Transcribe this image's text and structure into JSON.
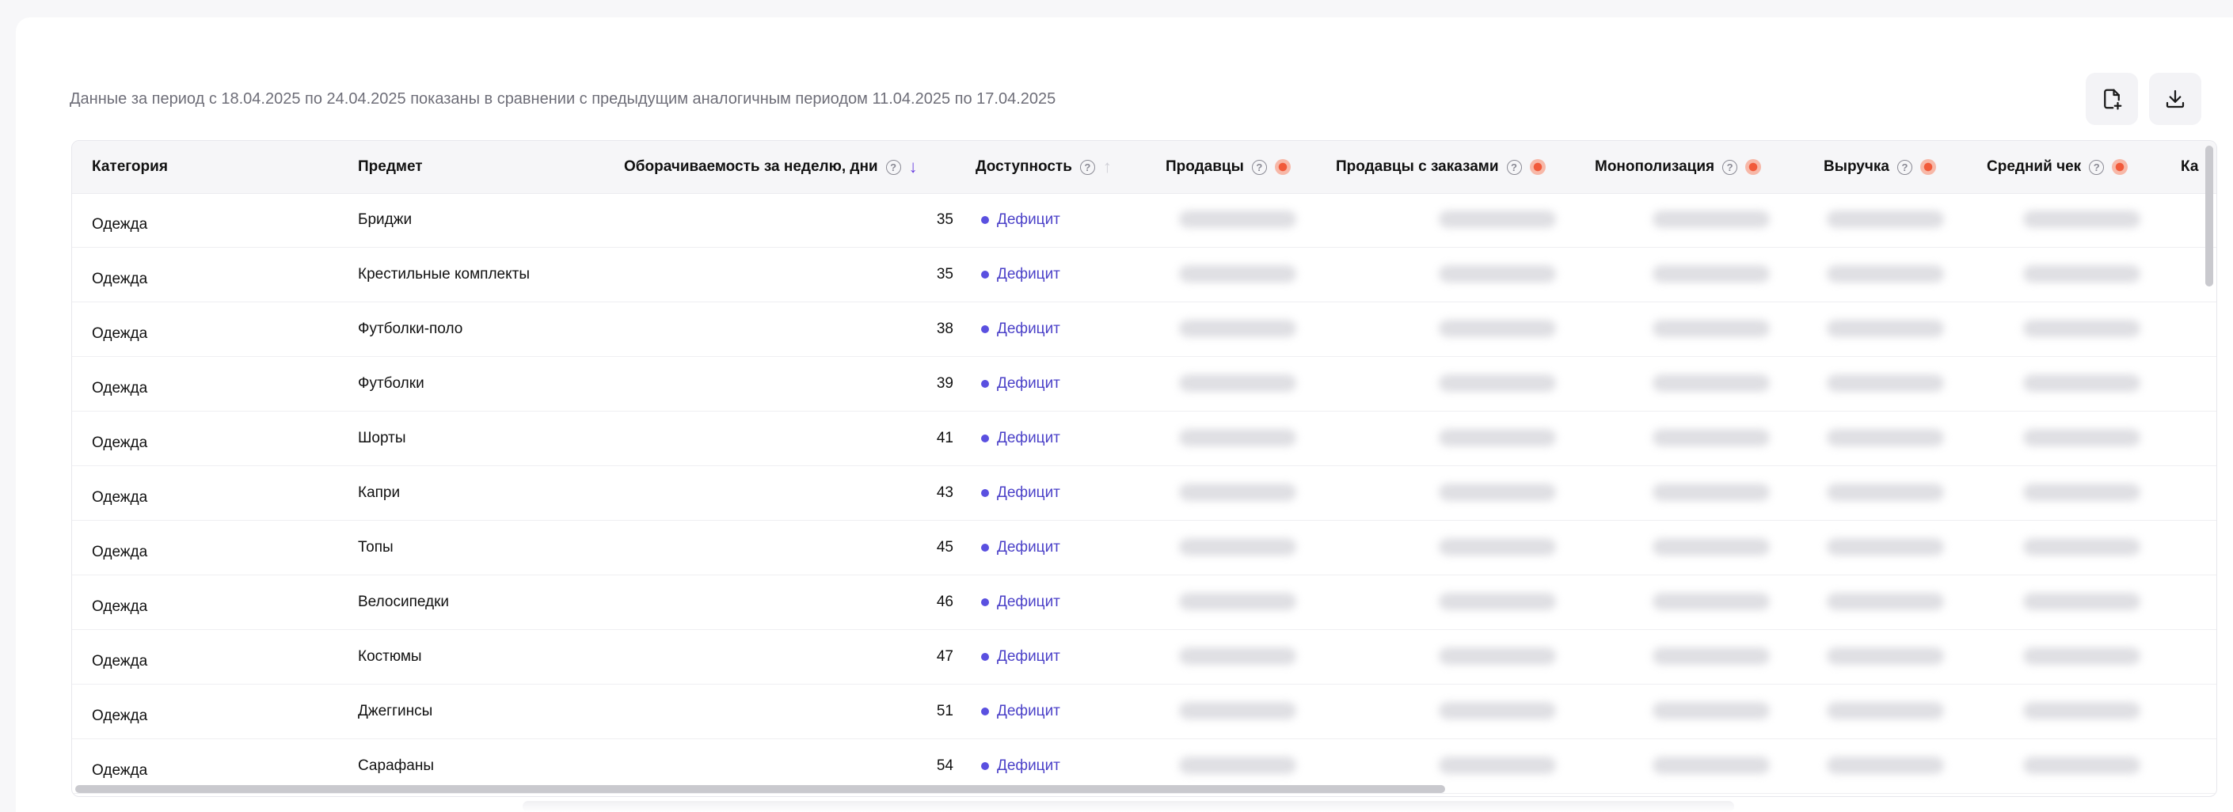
{
  "period_text": "Данные за период с 18.04.2025 по 24.04.2025 показаны в сравнении с предыдущим аналогичным периодом 11.04.2025 по 17.04.2025",
  "toolbar": {
    "export_icon": "file-plus-icon",
    "download_icon": "download-icon"
  },
  "columns": {
    "category": "Категория",
    "subject": "Предмет",
    "turnover": "Оборачиваемость за неделю, дни",
    "availability": "Доступность",
    "sellers": "Продавцы",
    "sellers_with_orders": "Продавцы с заказами",
    "monopolization": "Монополизация",
    "revenue": "Выручка",
    "avg_check": "Средний чек",
    "cut_off": "Ка"
  },
  "help_glyph": "?",
  "sort_icons": {
    "active": "↓",
    "inactive": "↑"
  },
  "colors": {
    "accent": "#6a3fe0",
    "availability_text": "#4b41c8",
    "lock_dot": "#f15a3a"
  },
  "rows": [
    {
      "category": "Одежда",
      "subject": "Бриджи",
      "turnover": "35",
      "availability": "Дефицит"
    },
    {
      "category": "Одежда",
      "subject": "Крестильные комплекты",
      "turnover": "35",
      "availability": "Дефицит"
    },
    {
      "category": "Одежда",
      "subject": "Футболки-поло",
      "turnover": "38",
      "availability": "Дефицит"
    },
    {
      "category": "Одежда",
      "subject": "Футболки",
      "turnover": "39",
      "availability": "Дефицит"
    },
    {
      "category": "Одежда",
      "subject": "Шорты",
      "turnover": "41",
      "availability": "Дефицит"
    },
    {
      "category": "Одежда",
      "subject": "Капри",
      "turnover": "43",
      "availability": "Дефицит"
    },
    {
      "category": "Одежда",
      "subject": "Топы",
      "turnover": "45",
      "availability": "Дефицит"
    },
    {
      "category": "Одежда",
      "subject": "Велосипедки",
      "turnover": "46",
      "availability": "Дефицит"
    },
    {
      "category": "Одежда",
      "subject": "Костюмы",
      "turnover": "47",
      "availability": "Дефицит"
    },
    {
      "category": "Одежда",
      "subject": "Джеггинсы",
      "turnover": "51",
      "availability": "Дефицит"
    },
    {
      "category": "Одежда",
      "subject": "Сарафаны",
      "turnover": "54",
      "availability": "Дефицит"
    }
  ]
}
